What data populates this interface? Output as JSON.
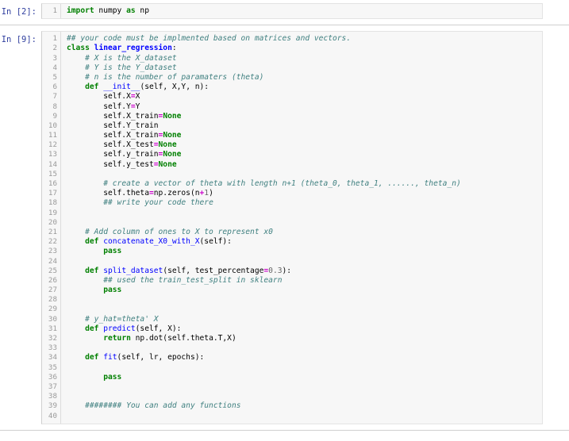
{
  "notebook": {
    "cells": [
      {
        "prompt": "In [2]:",
        "line_numbers": [
          "1"
        ],
        "lines": [
          [
            {
              "t": "import",
              "c": "k"
            },
            {
              "t": " numpy ",
              "c": "nt"
            },
            {
              "t": "as",
              "c": "k"
            },
            {
              "t": " np",
              "c": "nt"
            }
          ]
        ]
      },
      {
        "prompt": "In [9]:",
        "line_numbers": [
          "1",
          "2",
          "3",
          "4",
          "5",
          "6",
          "7",
          "8",
          "9",
          "10",
          "11",
          "12",
          "13",
          "14",
          "15",
          "16",
          "17",
          "18",
          "19",
          "20",
          "21",
          "22",
          "23",
          "24",
          "25",
          "26",
          "27",
          "28",
          "29",
          "30",
          "31",
          "32",
          "33",
          "34",
          "35",
          "36",
          "37",
          "38",
          "39",
          "40"
        ],
        "lines": [
          [
            {
              "t": "## your code must be implmented based on matrices and vectors.",
              "c": "cm"
            }
          ],
          [
            {
              "t": "class",
              "c": "k"
            },
            {
              "t": " ",
              "c": "nt"
            },
            {
              "t": "linear_regression",
              "c": "nc"
            },
            {
              "t": ":",
              "c": "nt"
            }
          ],
          [
            {
              "t": "    ",
              "c": "nt"
            },
            {
              "t": "# X is the X_dataset",
              "c": "cm"
            }
          ],
          [
            {
              "t": "    ",
              "c": "nt"
            },
            {
              "t": "# Y is the Y_dataset",
              "c": "cm"
            }
          ],
          [
            {
              "t": "    ",
              "c": "nt"
            },
            {
              "t": "# n is the number of paramaters (theta)",
              "c": "cm"
            }
          ],
          [
            {
              "t": "    ",
              "c": "nt"
            },
            {
              "t": "def",
              "c": "k"
            },
            {
              "t": " ",
              "c": "nt"
            },
            {
              "t": "__init__",
              "c": "fn"
            },
            {
              "t": "(self, X,Y, n):",
              "c": "nt"
            }
          ],
          [
            {
              "t": "        self.X",
              "c": "nt"
            },
            {
              "t": "=",
              "c": "eq"
            },
            {
              "t": "X",
              "c": "nt"
            }
          ],
          [
            {
              "t": "        self.Y",
              "c": "nt"
            },
            {
              "t": "=",
              "c": "eq"
            },
            {
              "t": "Y",
              "c": "nt"
            }
          ],
          [
            {
              "t": "        self.X_train",
              "c": "nt"
            },
            {
              "t": "=",
              "c": "eq"
            },
            {
              "t": "None",
              "c": "nb"
            }
          ],
          [
            {
              "t": "        self.Y_train",
              "c": "nt"
            }
          ],
          [
            {
              "t": "        self.X_train",
              "c": "nt"
            },
            {
              "t": "=",
              "c": "eq"
            },
            {
              "t": "None",
              "c": "nb"
            }
          ],
          [
            {
              "t": "        self.X_test",
              "c": "nt"
            },
            {
              "t": "=",
              "c": "eq"
            },
            {
              "t": "None",
              "c": "nb"
            }
          ],
          [
            {
              "t": "        self.y_train",
              "c": "nt"
            },
            {
              "t": "=",
              "c": "eq"
            },
            {
              "t": "None",
              "c": "nb"
            }
          ],
          [
            {
              "t": "        self.y_test",
              "c": "nt"
            },
            {
              "t": "=",
              "c": "eq"
            },
            {
              "t": "None",
              "c": "nb"
            }
          ],
          [
            {
              "t": "",
              "c": "nt"
            }
          ],
          [
            {
              "t": "        ",
              "c": "nt"
            },
            {
              "t": "# create a vector of theta with length n+1 (theta_0, theta_1, ......, theta_n)",
              "c": "cm"
            }
          ],
          [
            {
              "t": "        self.theta",
              "c": "nt"
            },
            {
              "t": "=",
              "c": "eq"
            },
            {
              "t": "np.zeros(n",
              "c": "nt"
            },
            {
              "t": "+",
              "c": "eq"
            },
            {
              "t": "1",
              "c": "mi"
            },
            {
              "t": ")",
              "c": "nt"
            }
          ],
          [
            {
              "t": "        ",
              "c": "nt"
            },
            {
              "t": "## write your code there",
              "c": "cm"
            }
          ],
          [
            {
              "t": "",
              "c": "nt"
            }
          ],
          [
            {
              "t": "",
              "c": "nt"
            }
          ],
          [
            {
              "t": "    ",
              "c": "nt"
            },
            {
              "t": "# Add column of ones to X to represent x0",
              "c": "cm"
            }
          ],
          [
            {
              "t": "    ",
              "c": "nt"
            },
            {
              "t": "def",
              "c": "k"
            },
            {
              "t": " ",
              "c": "nt"
            },
            {
              "t": "concatenate_X0_with_X",
              "c": "fn"
            },
            {
              "t": "(self):",
              "c": "nt"
            }
          ],
          [
            {
              "t": "        ",
              "c": "nt"
            },
            {
              "t": "pass",
              "c": "k"
            }
          ],
          [
            {
              "t": "",
              "c": "nt"
            }
          ],
          [
            {
              "t": "    ",
              "c": "nt"
            },
            {
              "t": "def",
              "c": "k"
            },
            {
              "t": " ",
              "c": "nt"
            },
            {
              "t": "split_dataset",
              "c": "fn"
            },
            {
              "t": "(self, test_percentage",
              "c": "nt"
            },
            {
              "t": "=",
              "c": "eq"
            },
            {
              "t": "0.3",
              "c": "mi"
            },
            {
              "t": "):",
              "c": "nt"
            }
          ],
          [
            {
              "t": "        ",
              "c": "nt"
            },
            {
              "t": "## used the train_test_split in sklearn",
              "c": "cm"
            }
          ],
          [
            {
              "t": "        ",
              "c": "nt"
            },
            {
              "t": "pass",
              "c": "k"
            }
          ],
          [
            {
              "t": "",
              "c": "nt"
            }
          ],
          [
            {
              "t": "",
              "c": "nt"
            }
          ],
          [
            {
              "t": "    ",
              "c": "nt"
            },
            {
              "t": "# y_hat=theta' X",
              "c": "cm"
            }
          ],
          [
            {
              "t": "    ",
              "c": "nt"
            },
            {
              "t": "def",
              "c": "k"
            },
            {
              "t": " ",
              "c": "nt"
            },
            {
              "t": "predict",
              "c": "fn"
            },
            {
              "t": "(self, X):",
              "c": "nt"
            }
          ],
          [
            {
              "t": "        ",
              "c": "nt"
            },
            {
              "t": "return",
              "c": "k"
            },
            {
              "t": " np.dot(self.theta.T,X)",
              "c": "nt"
            }
          ],
          [
            {
              "t": "",
              "c": "nt"
            }
          ],
          [
            {
              "t": "    ",
              "c": "nt"
            },
            {
              "t": "def",
              "c": "k"
            },
            {
              "t": " ",
              "c": "nt"
            },
            {
              "t": "fit",
              "c": "fn"
            },
            {
              "t": "(self, lr, epochs):",
              "c": "nt"
            }
          ],
          [
            {
              "t": "",
              "c": "nt"
            }
          ],
          [
            {
              "t": "        ",
              "c": "nt"
            },
            {
              "t": "pass",
              "c": "k"
            }
          ],
          [
            {
              "t": "",
              "c": "nt"
            }
          ],
          [
            {
              "t": "",
              "c": "nt"
            }
          ],
          [
            {
              "t": "    ",
              "c": "nt"
            },
            {
              "t": "######## You can add any functions",
              "c": "cm"
            }
          ],
          [
            {
              "t": "",
              "c": "nt"
            }
          ]
        ]
      }
    ]
  },
  "theme": {
    "cell_background": "#f7f7f7",
    "page_background": "#ffffff",
    "prompt_color": "#303f9f",
    "gutter_color": "#999999",
    "keyword_color": "#008000",
    "comment_color": "#408080",
    "classname_color": "#0000ff",
    "operator_color": "#cc00cc",
    "number_color": "#666666",
    "separator_color": "#d0d0d0"
  }
}
